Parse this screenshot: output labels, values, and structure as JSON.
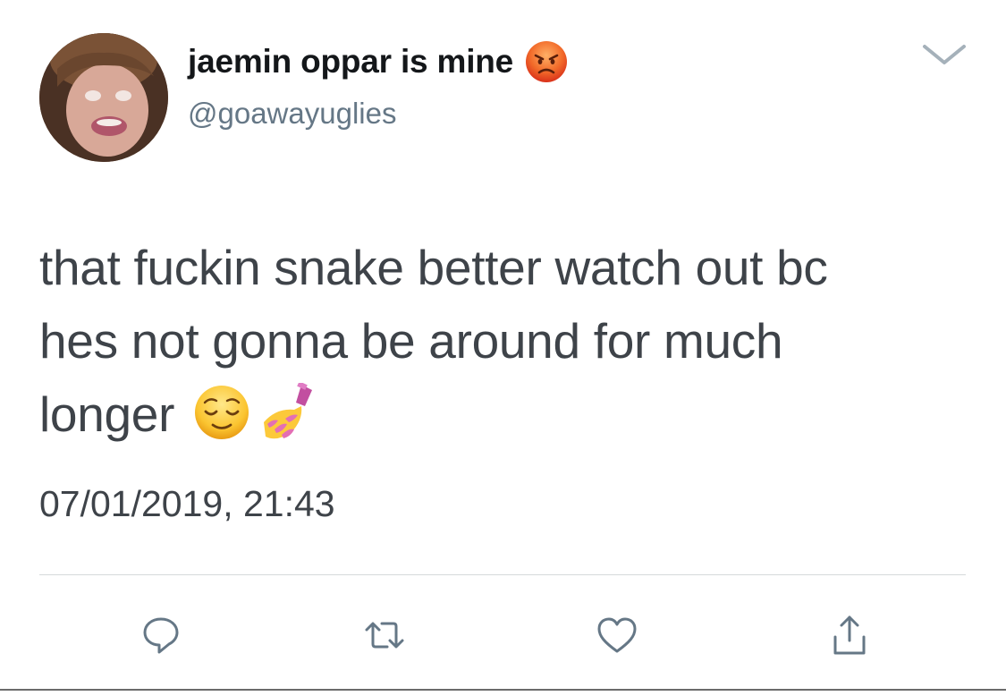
{
  "tweet": {
    "display_name": "jaemin oppar is mine",
    "name_emoji": "angry-face-emoji",
    "handle": "@goawayuglies",
    "text_line_1": "that fuckin snake better watch out bc",
    "text_line_2": "hes not gonna be around for much",
    "text_line_3": "longer",
    "text_emojis": [
      "relieved-face-emoji",
      "nail-polish-emoji"
    ],
    "timestamp": "07/01/2019, 21:43"
  },
  "actions": [
    "reply-icon",
    "retweet-icon",
    "like-icon",
    "share-icon"
  ],
  "colors": {
    "name": "#14171a",
    "handle": "#657786",
    "body_text": "#3e4349",
    "icon": "#657786",
    "divider": "#d6d9db"
  }
}
